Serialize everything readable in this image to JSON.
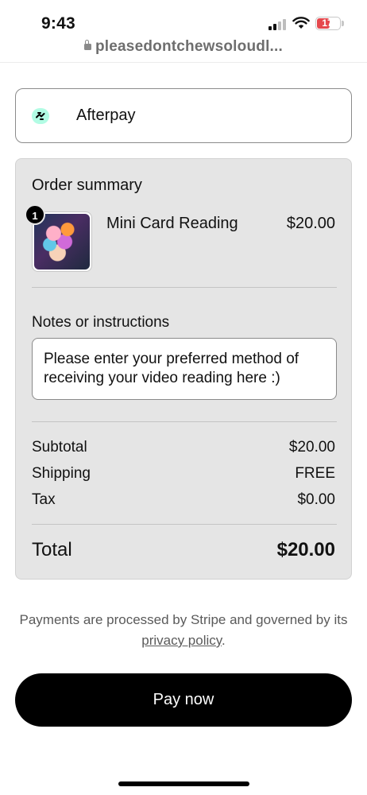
{
  "status_bar": {
    "time": "9:43",
    "battery": "17",
    "battery_color": "#e5484d"
  },
  "browser": {
    "url": "pleasedontchewsoloudl..."
  },
  "payment": {
    "option_label": "Afterpay",
    "icon": "afterpay-icon",
    "icon_color": "#b2fce4"
  },
  "order_summary": {
    "title": "Order summary",
    "item": {
      "quantity": "1",
      "name": "Mini Card Reading",
      "price": "$20.00"
    },
    "notes": {
      "label": "Notes or instructions",
      "value": "Please enter your preferred method of receiving your video reading here :)"
    },
    "subtotal_label": "Subtotal",
    "subtotal_value": "$20.00",
    "shipping_label": "Shipping",
    "shipping_value": "FREE",
    "tax_label": "Tax",
    "tax_value": "$0.00",
    "total_label": "Total",
    "total_value": "$20.00"
  },
  "disclaimer": {
    "text_before": "Payments are processed by Stripe and governed by its ",
    "link_text": "privacy policy",
    "text_after": "."
  },
  "pay_button": {
    "label": "Pay now"
  }
}
